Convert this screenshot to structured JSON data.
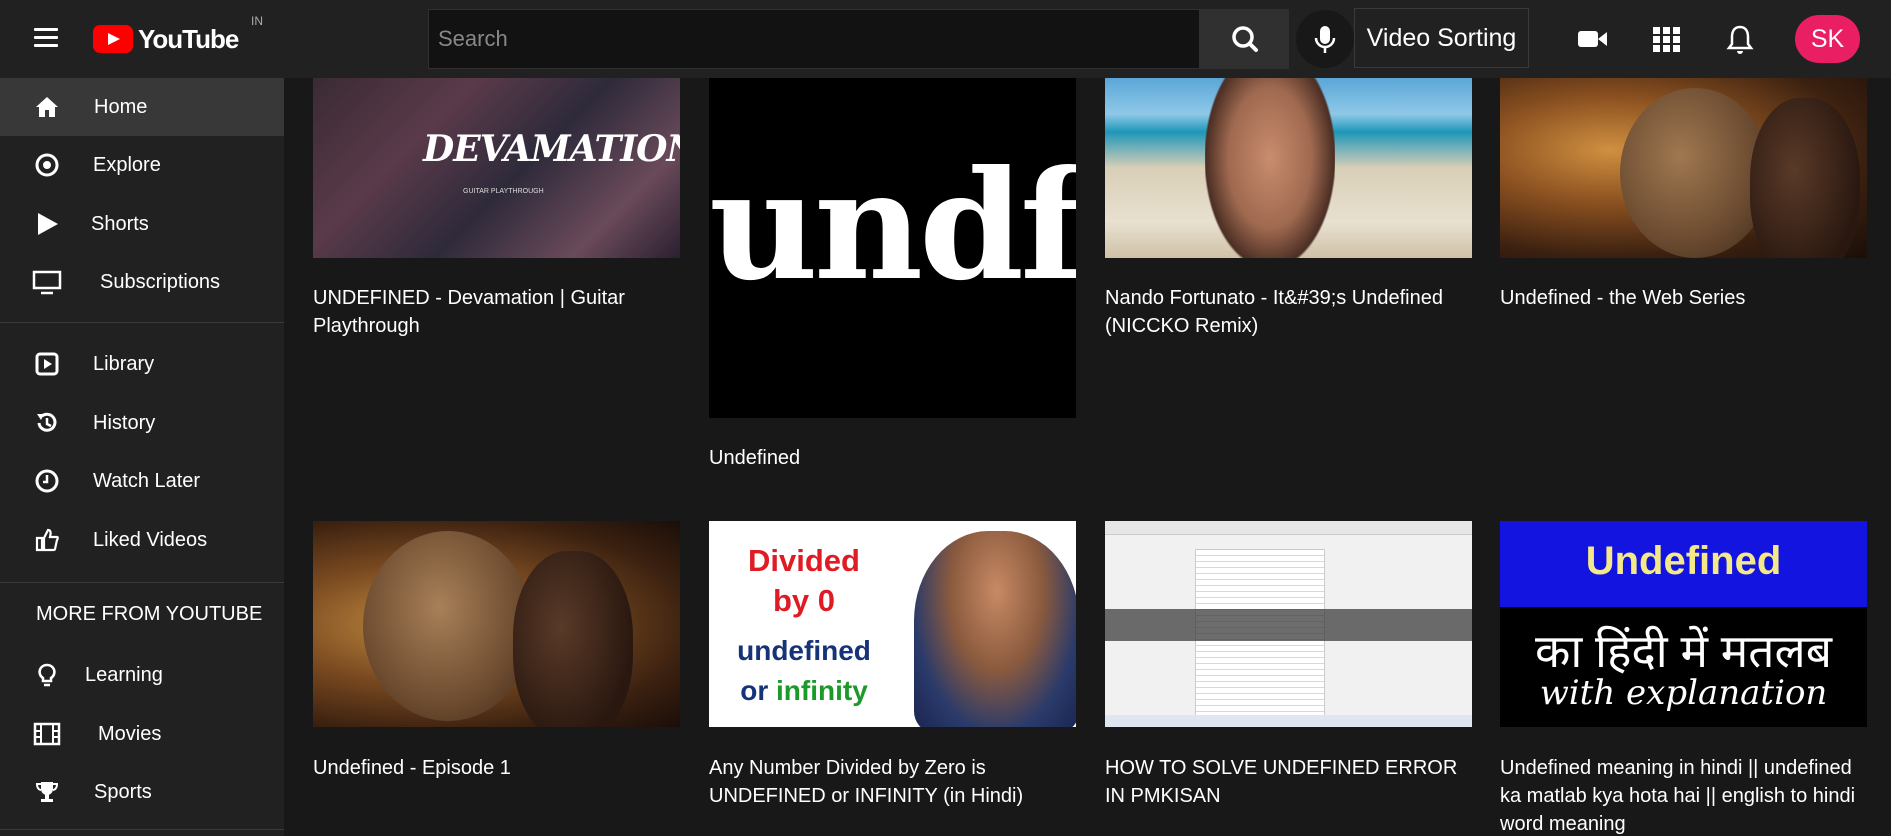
{
  "header": {
    "logo_text": "YouTube",
    "country_code": "IN",
    "search_placeholder": "Search",
    "sort_label": "Video Sorting",
    "avatar_initials": "SK",
    "avatar_color": "#e91e63",
    "brand_color": "#ff0000"
  },
  "sidebar": {
    "items": [
      {
        "label": "Home",
        "icon": "home-icon",
        "active": true
      },
      {
        "label": "Explore",
        "icon": "compass-icon"
      },
      {
        "label": "Shorts",
        "icon": "play-icon"
      },
      {
        "label": "Subscriptions",
        "icon": "monitor-icon"
      },
      {
        "label": "Library",
        "icon": "library-icon"
      },
      {
        "label": "History",
        "icon": "history-icon"
      },
      {
        "label": "Watch Later",
        "icon": "clock-icon"
      },
      {
        "label": "Liked Videos",
        "icon": "thumbs-up-icon"
      }
    ],
    "more_heading": "MORE FROM YOUTUBE",
    "more_items": [
      {
        "label": "Learning",
        "icon": "lightbulb-icon"
      },
      {
        "label": "Movies",
        "icon": "film-icon"
      },
      {
        "label": "Sports",
        "icon": "trophy-icon"
      }
    ]
  },
  "videos": [
    {
      "title": "UNDEFINED - Devamation | Guitar Playthrough",
      "thumb_text": "DEVAMATION",
      "thumb_subtext": "GUITAR PLAYTHROUGH"
    },
    {
      "title": "Undefined",
      "thumb_text": "undf"
    },
    {
      "title": "Nando Fortunato - It&#39;s Undefined (NICCKO Remix)"
    },
    {
      "title": "Undefined - the Web Series"
    },
    {
      "title": "Undefined - Episode 1"
    },
    {
      "title": "Any Number Divided by Zero is UNDEFINED or INFINITY (in Hindi)",
      "thumb_lines": [
        "Divided",
        "by 0",
        "undefined",
        "or",
        "infinity"
      ]
    },
    {
      "title": "HOW TO SOLVE UNDEFINED ERROR IN PMKISAN"
    },
    {
      "title": "Undefined meaning in hindi || undefined ka matlab kya hota hai || english to hindi word meaning",
      "thumb_lines": [
        "Undefined",
        "का हिंदी में मतलब",
        "with explanation"
      ]
    }
  ]
}
